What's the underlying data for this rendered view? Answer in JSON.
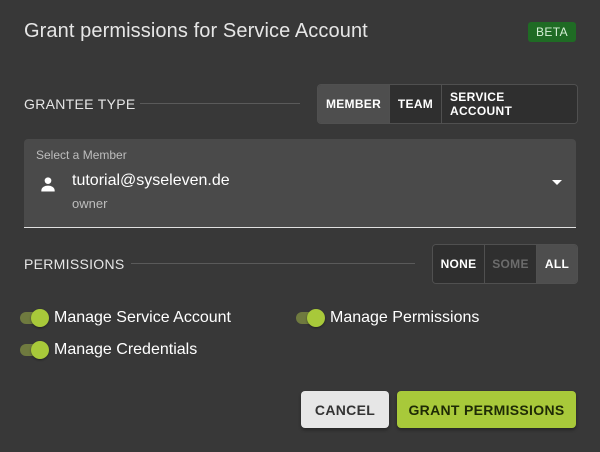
{
  "dialog": {
    "title": "Grant permissions for Service Account",
    "badge": "BETA"
  },
  "grantee_type": {
    "label": "GRANTEE TYPE",
    "options": [
      "MEMBER",
      "TEAM",
      "SERVICE ACCOUNT"
    ],
    "selected": "MEMBER"
  },
  "member_select": {
    "label": "Select a Member",
    "icon": "person-icon",
    "value": "tutorial@syseleven.de",
    "sublabel": "owner"
  },
  "permissions": {
    "label": "PERMISSIONS",
    "options": [
      "NONE",
      "SOME",
      "ALL"
    ],
    "selected": "ALL",
    "disabled": [
      "SOME"
    ],
    "items": [
      {
        "label": "Manage Service Account",
        "enabled": true
      },
      {
        "label": "Manage Permissions",
        "enabled": true
      },
      {
        "label": "Manage Credentials",
        "enabled": true
      }
    ]
  },
  "actions": {
    "cancel": "CANCEL",
    "submit": "GRANT PERMISSIONS"
  },
  "colors": {
    "background": "#383838",
    "accent": "#a8c93a",
    "badge": "#1f6b24"
  }
}
